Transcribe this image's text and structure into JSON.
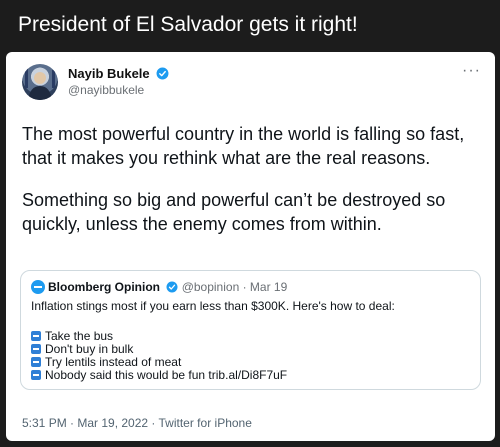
{
  "post": {
    "title": "President of El Salvador gets it right!"
  },
  "tweet": {
    "author_name": "Nayib Bukele",
    "author_handle": "@nayibbukele",
    "more": "···",
    "paragraphs": [
      "The most powerful country in the world is falling so fast, that it makes you rethink what are the real reasons.",
      "Something so big and powerful can’t be destroyed so quickly, unless the enemy comes from within."
    ],
    "footer": "5:31 PM · Mar 19, 2022 · Twitter for iPhone"
  },
  "quote": {
    "author_name": "Bloomberg Opinion",
    "meta": "@bopinion · Mar 19",
    "text": "Inflation stings most if you earn less than $300K. Here's how to deal:",
    "items": [
      "Take the bus",
      "Don't buy in bulk",
      "Try lentils instead of meat",
      "Nobody said this would be fun trib.al/Di8F7uF"
    ]
  },
  "colors": {
    "verified": "#1d9bf0",
    "bullet": "#2f7fd6",
    "header_bg": "#1c1c1c"
  }
}
